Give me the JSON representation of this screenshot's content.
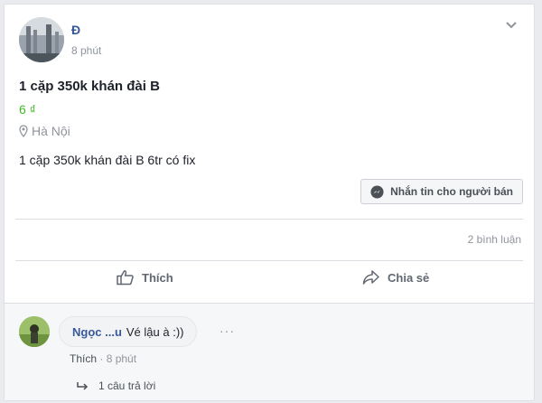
{
  "post": {
    "author": "Đ",
    "time": "8 phút",
    "title": "1 cặp 350k khán đài B",
    "price": "6 ₫",
    "location": "Hà Nội",
    "description": "1 cặp 350k khán đài B 6tr có fix",
    "message_button": "Nhắn tin cho người bán",
    "comment_count": "2 bình luận",
    "like_label": "Thích",
    "share_label": "Chia sẻ"
  },
  "comment": {
    "author": "Ngọc ...u",
    "text": "Vé lậu à :))",
    "more": "···",
    "like": "Thích",
    "separator": "·",
    "time": "8 phút",
    "replies": "1 câu trả lời"
  },
  "colors": {
    "link": "#365899",
    "price": "#42b72a",
    "messenger": "#0084ff"
  }
}
